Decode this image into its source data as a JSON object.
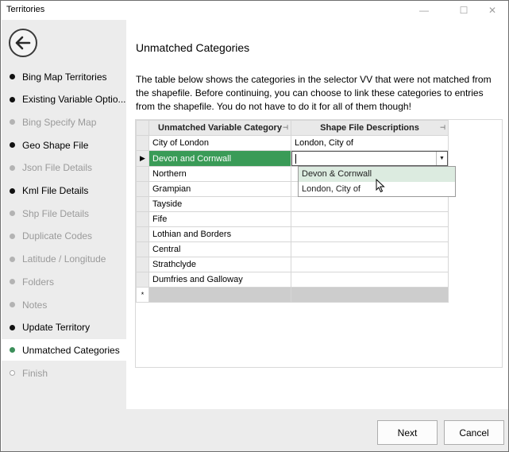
{
  "window": {
    "title": "Territories",
    "controls": {
      "minimize": "—",
      "maximize": "☐",
      "close": "✕"
    }
  },
  "sidebar": {
    "items": [
      {
        "label": "Bing Map Territories",
        "state": "done"
      },
      {
        "label": "Existing Variable Optio...",
        "state": "done"
      },
      {
        "label": "Bing Specify Map",
        "state": "todo"
      },
      {
        "label": "Geo Shape File",
        "state": "done"
      },
      {
        "label": "Json File Details",
        "state": "todo"
      },
      {
        "label": "Kml File Details",
        "state": "done"
      },
      {
        "label": "Shp File Details",
        "state": "todo"
      },
      {
        "label": "Duplicate Codes",
        "state": "todo"
      },
      {
        "label": "Latitude / Longitude",
        "state": "todo"
      },
      {
        "label": "Folders",
        "state": "todo"
      },
      {
        "label": "Notes",
        "state": "todo"
      },
      {
        "label": "Update Territory",
        "state": "done"
      },
      {
        "label": "Unmatched Categories",
        "state": "active"
      },
      {
        "label": "Finish",
        "state": "future"
      }
    ]
  },
  "main": {
    "heading": "Unmatched Categories",
    "description": "The table below shows the categories in the selector VV that were not matched from the shapefile. Before continuing, you can choose to link these categories to entries from the shapefile. You do not have to do it for all of them though!",
    "grid": {
      "columns": [
        "Unmatched Variable Category",
        "Shape File Descriptions"
      ],
      "rows": [
        {
          "category": "City of London",
          "description": "London, City of"
        },
        {
          "category": "Devon and Cornwall",
          "description": ""
        },
        {
          "category": "Northern",
          "description": ""
        },
        {
          "category": "Grampian",
          "description": ""
        },
        {
          "category": "Tayside",
          "description": ""
        },
        {
          "category": "Fife",
          "description": ""
        },
        {
          "category": "Lothian and Borders",
          "description": ""
        },
        {
          "category": "Central",
          "description": ""
        },
        {
          "category": "Strathclyde",
          "description": ""
        },
        {
          "category": "Dumfries and Galloway",
          "description": ""
        }
      ],
      "selected_row_indicator": "▶",
      "new_row_indicator": "*",
      "dropdown_options": [
        "Devon & Cornwall",
        "London, City of"
      ]
    }
  },
  "footer": {
    "next_label": "Next",
    "cancel_label": "Cancel"
  },
  "colors": {
    "selected_row": "#3a9b57",
    "active_dot": "#3c8f5a",
    "hover_option": "#dcebe0"
  }
}
